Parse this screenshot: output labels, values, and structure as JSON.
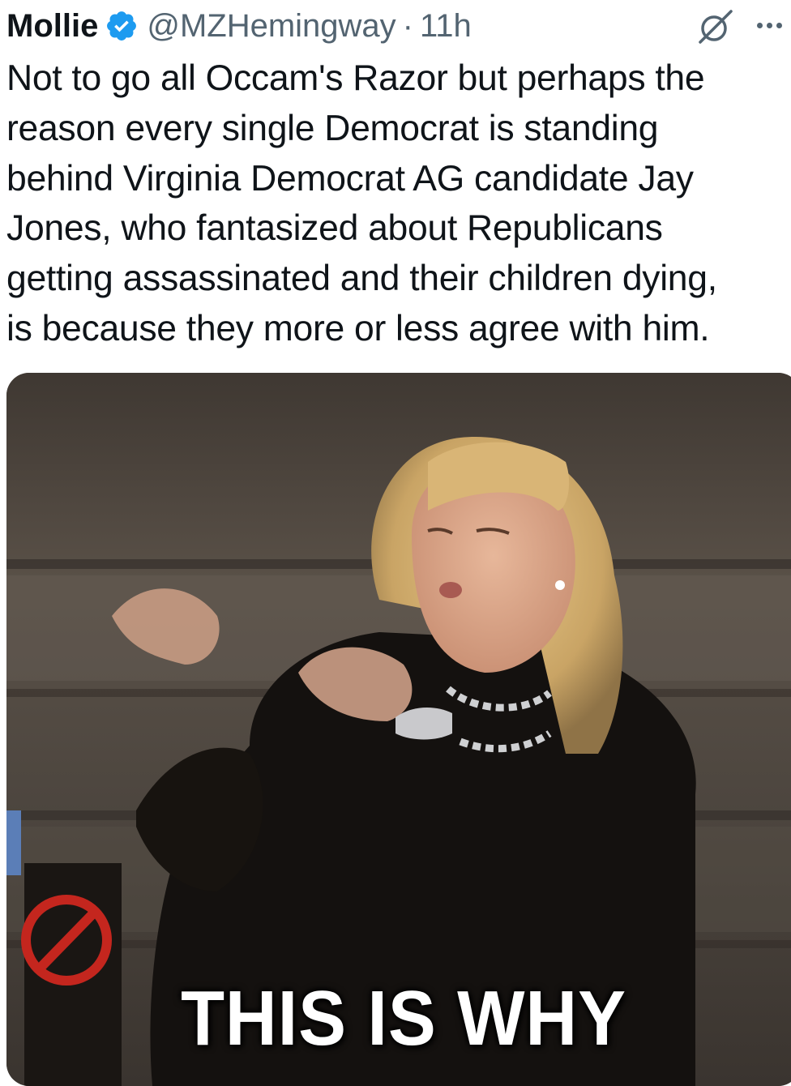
{
  "tweet": {
    "display_name": "Mollie",
    "handle": "@MZHemingway",
    "separator": "·",
    "time": "11h",
    "verified": true,
    "text_lines": [
      "Not to go all Occam's Razor but perhaps the",
      "reason every single Democrat is standing",
      "behind Virginia Democrat AG candidate Jay",
      "Jones, who fantasized about Republicans",
      "getting assassinated and their children dying,",
      "is because they more or less agree with him."
    ],
    "icons": {
      "verified": "verified-badge-icon",
      "grok": "grok-icon",
      "more": "more-options-icon"
    },
    "colors": {
      "verified_badge": "#1d9bf0",
      "secondary_text": "#536471",
      "primary_text": "#0f1419"
    }
  },
  "media": {
    "type": "gif",
    "caption": "THIS IS WHY"
  }
}
